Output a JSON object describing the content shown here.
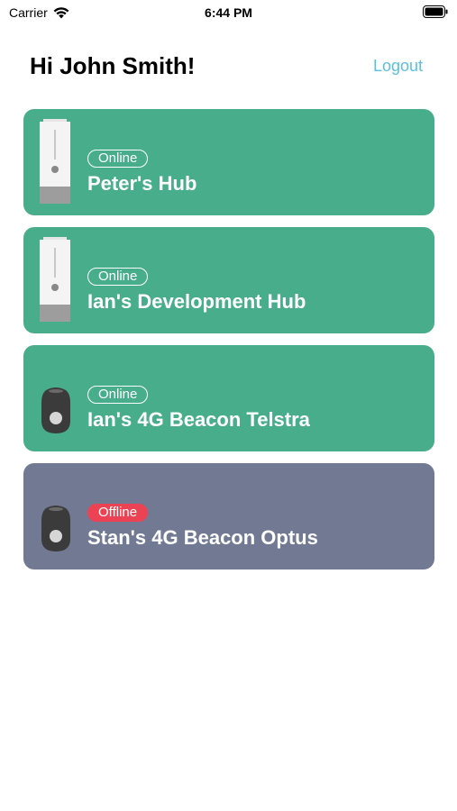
{
  "status_bar": {
    "carrier": "Carrier",
    "time": "6:44 PM"
  },
  "header": {
    "greeting": "Hi John Smith!",
    "logout_label": "Logout"
  },
  "colors": {
    "online_card": "#48ad8a",
    "offline_card": "#717993",
    "offline_badge": "#ec4354",
    "logout": "#5bc0de"
  },
  "devices": [
    {
      "name": "Peter's Hub",
      "status": "Online",
      "type": "hub-icon"
    },
    {
      "name": "Ian's Development Hub",
      "status": "Online",
      "type": "hub-icon"
    },
    {
      "name": "Ian's 4G Beacon Telstra",
      "status": "Online",
      "type": "beacon-icon"
    },
    {
      "name": "Stan's 4G Beacon Optus",
      "status": "Offline",
      "type": "beacon-icon"
    }
  ]
}
